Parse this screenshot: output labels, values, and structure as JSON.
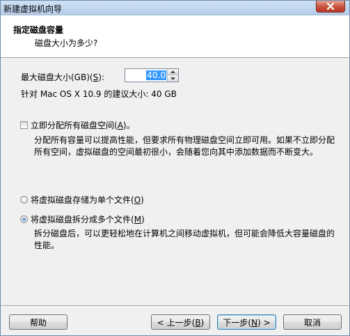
{
  "window": {
    "title": "新建虚拟机向导"
  },
  "header": {
    "title": "指定磁盘容量",
    "subtitle": "磁盘大小为多少?"
  },
  "disk_size": {
    "label_prefix": "最大磁盘大小(GB)(",
    "label_accel": "S",
    "label_suffix": "):",
    "value": "40.0"
  },
  "recommendation": {
    "text": "针对 Mac OS X 10.9 的建议大小: 40 GB"
  },
  "allocate_now": {
    "label_prefix": "立即分配所有磁盘空间(",
    "label_accel": "A",
    "label_suffix": ")。",
    "checked": false,
    "description": "分配所有容量可以提高性能，但要求所有物理磁盘空间立即可用。如果不立即分配所有空间，虚拟磁盘的空间最初很小，会随着您向其中添加数据而不断变大。"
  },
  "storage_options": [
    {
      "label_prefix": "将虚拟磁盘存储为单个文件(",
      "label_accel": "O",
      "label_suffix": ")",
      "selected": false
    },
    {
      "label_prefix": "将虚拟磁盘拆分成多个文件(",
      "label_accel": "M",
      "label_suffix": ")",
      "selected": true
    }
  ],
  "split_description": "拆分磁盘后，可以更轻松地在计算机之间移动虚拟机，但可能会降低大容量磁盘的性能。",
  "buttons": {
    "help": "帮助",
    "back_prefix": "< 上一步(",
    "back_accel": "B",
    "back_suffix": ")",
    "next_prefix": "下一步(",
    "next_accel": "N",
    "next_suffix": ") >",
    "cancel": "取消"
  },
  "colors": {
    "selection": "#3399ff",
    "default_button_border": "#3c7fb1"
  }
}
